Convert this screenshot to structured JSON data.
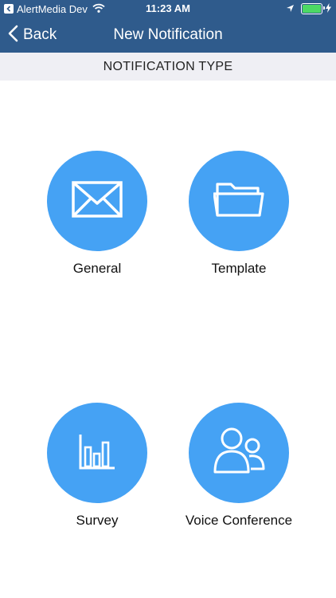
{
  "status_bar": {
    "back_app": "AlertMedia Dev",
    "time": "11:23 AM",
    "battery_level": 1.0,
    "icons": [
      "back-to-app-icon",
      "wifi-icon",
      "location-arrow-icon",
      "battery-icon",
      "charging-bolt-icon"
    ]
  },
  "nav": {
    "back_label": "Back",
    "title": "New Notification",
    "back_icon": "chevron-left-icon"
  },
  "section": {
    "header": "NOTIFICATION TYPE"
  },
  "options": [
    {
      "label": "General",
      "icon": "envelope-icon"
    },
    {
      "label": "Template",
      "icon": "folder-icon"
    },
    {
      "label": "Survey",
      "icon": "bar-chart-icon"
    },
    {
      "label": "Voice Conference",
      "icon": "people-icon"
    }
  ],
  "colors": {
    "header_bg": "#2f5b8c",
    "accent": "#45a2f4",
    "section_bg": "#efeff4",
    "battery": "#4cd964"
  }
}
